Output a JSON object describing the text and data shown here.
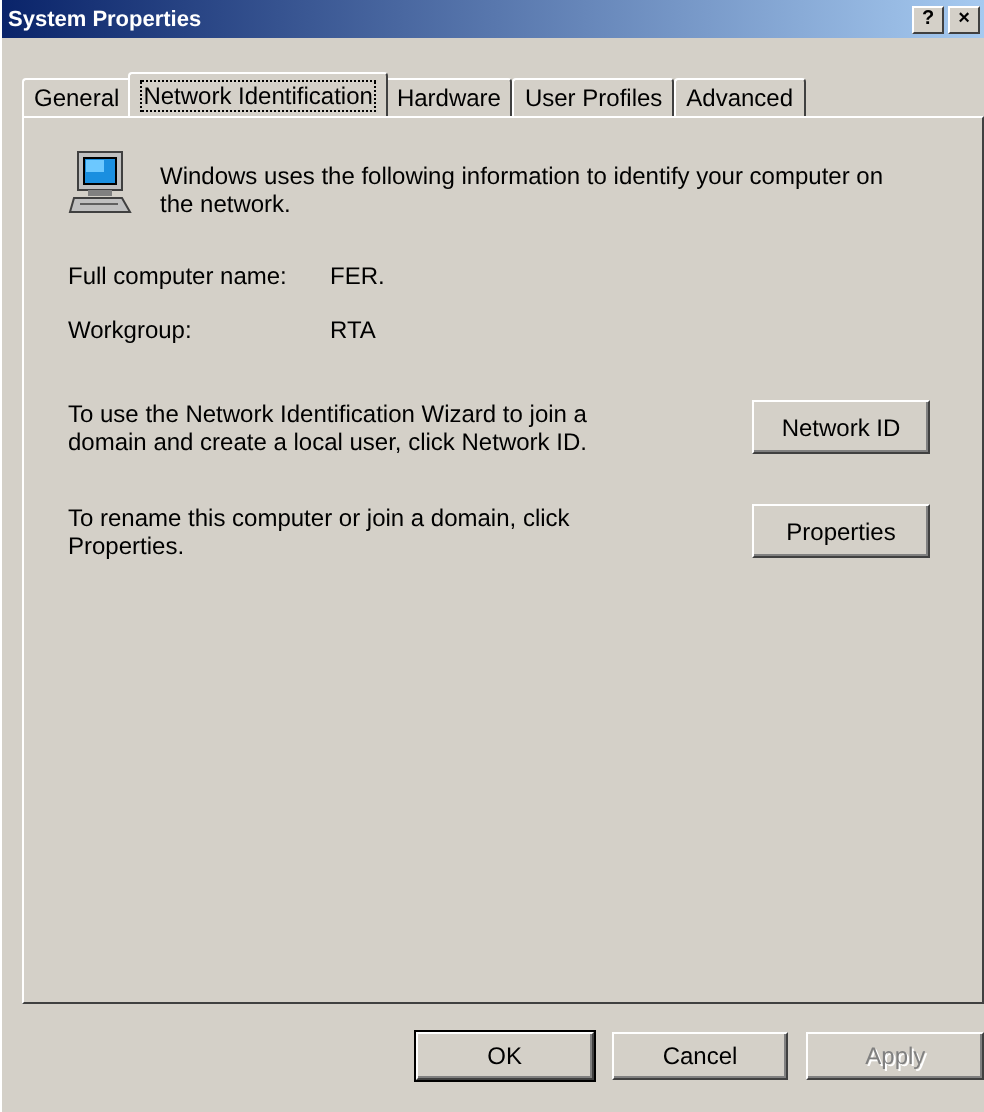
{
  "window": {
    "title": "System Properties",
    "help_button": "?",
    "close_button": "×"
  },
  "tabs": [
    {
      "label": "General",
      "selected": false
    },
    {
      "label": "Network Identification",
      "selected": true
    },
    {
      "label": "Hardware",
      "selected": false
    },
    {
      "label": "User Profiles",
      "selected": false
    },
    {
      "label": "Advanced",
      "selected": false
    }
  ],
  "intro": "Windows uses the following information to identify your computer on the network.",
  "fields": [
    {
      "label": "Full computer name:",
      "value": "FER."
    },
    {
      "label": "Workgroup:",
      "value": "RTA"
    }
  ],
  "actions": [
    {
      "text": "To use the Network Identification Wizard to join a domain and create a local user, click Network ID.",
      "button": "Network ID"
    },
    {
      "text": "To rename this computer or join a domain, click Properties.",
      "button": "Properties"
    }
  ],
  "buttons": [
    {
      "label": "OK",
      "default": true,
      "disabled": false
    },
    {
      "label": "Cancel",
      "default": false,
      "disabled": false
    },
    {
      "label": "Apply",
      "default": false,
      "disabled": true
    }
  ]
}
